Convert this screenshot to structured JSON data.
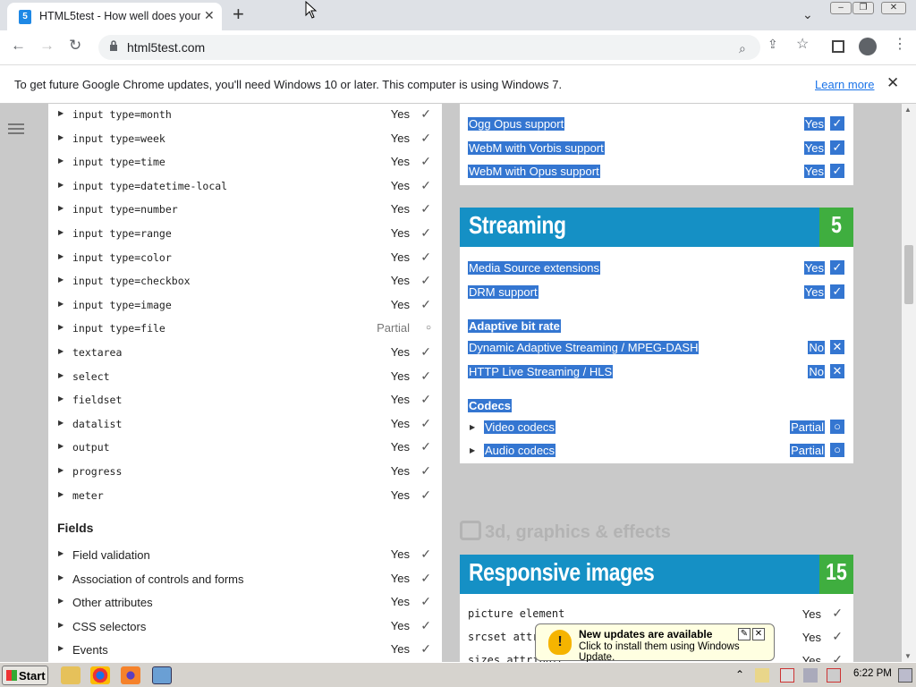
{
  "browser": {
    "tab_title": "HTML5test - How well does your",
    "tab_favicon": "5",
    "newtab": "+",
    "url": "html5test.com"
  },
  "infobar": {
    "message": "To get future Google Chrome updates, you'll need Windows 10 or later. This computer is using Windows 7.",
    "link": "Learn more"
  },
  "left_rows": [
    {
      "label": "input type=month",
      "value": "Yes",
      "mono": true
    },
    {
      "label": "input type=week",
      "value": "Yes",
      "mono": true
    },
    {
      "label": "input type=time",
      "value": "Yes",
      "mono": true
    },
    {
      "label": "input type=datetime-local",
      "value": "Yes",
      "mono": true
    },
    {
      "label": "input type=number",
      "value": "Yes",
      "mono": true
    },
    {
      "label": "input type=range",
      "value": "Yes",
      "mono": true
    },
    {
      "label": "input type=color",
      "value": "Yes",
      "mono": true
    },
    {
      "label": "input type=checkbox",
      "value": "Yes",
      "mono": true
    },
    {
      "label": "input type=image",
      "value": "Yes",
      "mono": true
    },
    {
      "label": "input type=file",
      "value": "Partial",
      "mono": true
    },
    {
      "label": "textarea",
      "value": "Yes",
      "mono": true
    },
    {
      "label": "select",
      "value": "Yes",
      "mono": true
    },
    {
      "label": "fieldset",
      "value": "Yes",
      "mono": true
    },
    {
      "label": "datalist",
      "value": "Yes",
      "mono": true
    },
    {
      "label": "output",
      "value": "Yes",
      "mono": true
    },
    {
      "label": "progress",
      "value": "Yes",
      "mono": true
    },
    {
      "label": "meter",
      "value": "Yes",
      "mono": true
    }
  ],
  "fields_heading": "Fields",
  "field_rows": [
    {
      "label": "Field validation",
      "value": "Yes"
    },
    {
      "label": "Association of controls and forms",
      "value": "Yes"
    },
    {
      "label": "Other attributes",
      "value": "Yes"
    },
    {
      "label": "CSS selectors",
      "value": "Yes"
    },
    {
      "label": "Events",
      "value": "Yes"
    }
  ],
  "audio_rows": [
    {
      "label": "Ogg Opus support",
      "value": "Yes"
    },
    {
      "label": "WebM with Vorbis support",
      "value": "Yes"
    },
    {
      "label": "WebM with Opus support",
      "value": "Yes"
    }
  ],
  "streaming": {
    "title": "Streaming",
    "score": "5",
    "rows": [
      {
        "label": "Media Source extensions",
        "value": "Yes"
      },
      {
        "label": "DRM support",
        "value": "Yes"
      }
    ],
    "adaptive_heading": "Adaptive bit rate",
    "adaptive_rows": [
      {
        "label": "Dynamic Adaptive Streaming / MPEG-DASH",
        "value": "No"
      },
      {
        "label": "HTTP Live Streaming / HLS",
        "value": "No"
      }
    ],
    "codecs_heading": "Codecs",
    "codec_rows": [
      {
        "label": "Video codecs",
        "value": "Partial"
      },
      {
        "label": "Audio codecs",
        "value": "Partial"
      }
    ]
  },
  "section_3d": "3d, graphics & effects",
  "responsive": {
    "title": "Responsive images",
    "score": "15",
    "rows": [
      {
        "label": "picture element",
        "value": "Yes"
      },
      {
        "label": "srcset attribute",
        "value": "Yes"
      },
      {
        "label": "sizes attribute",
        "value": "Yes"
      }
    ]
  },
  "balloon": {
    "title": "New updates are available",
    "subtitle": "Click to install them using Windows Update."
  },
  "taskbar": {
    "start": "Start",
    "clock": "6:22 PM"
  },
  "colors": {
    "selection": "#3476d1",
    "banner_blue": "#1590c5",
    "score_green": "#3fae3f",
    "link": "#1a73e8"
  }
}
